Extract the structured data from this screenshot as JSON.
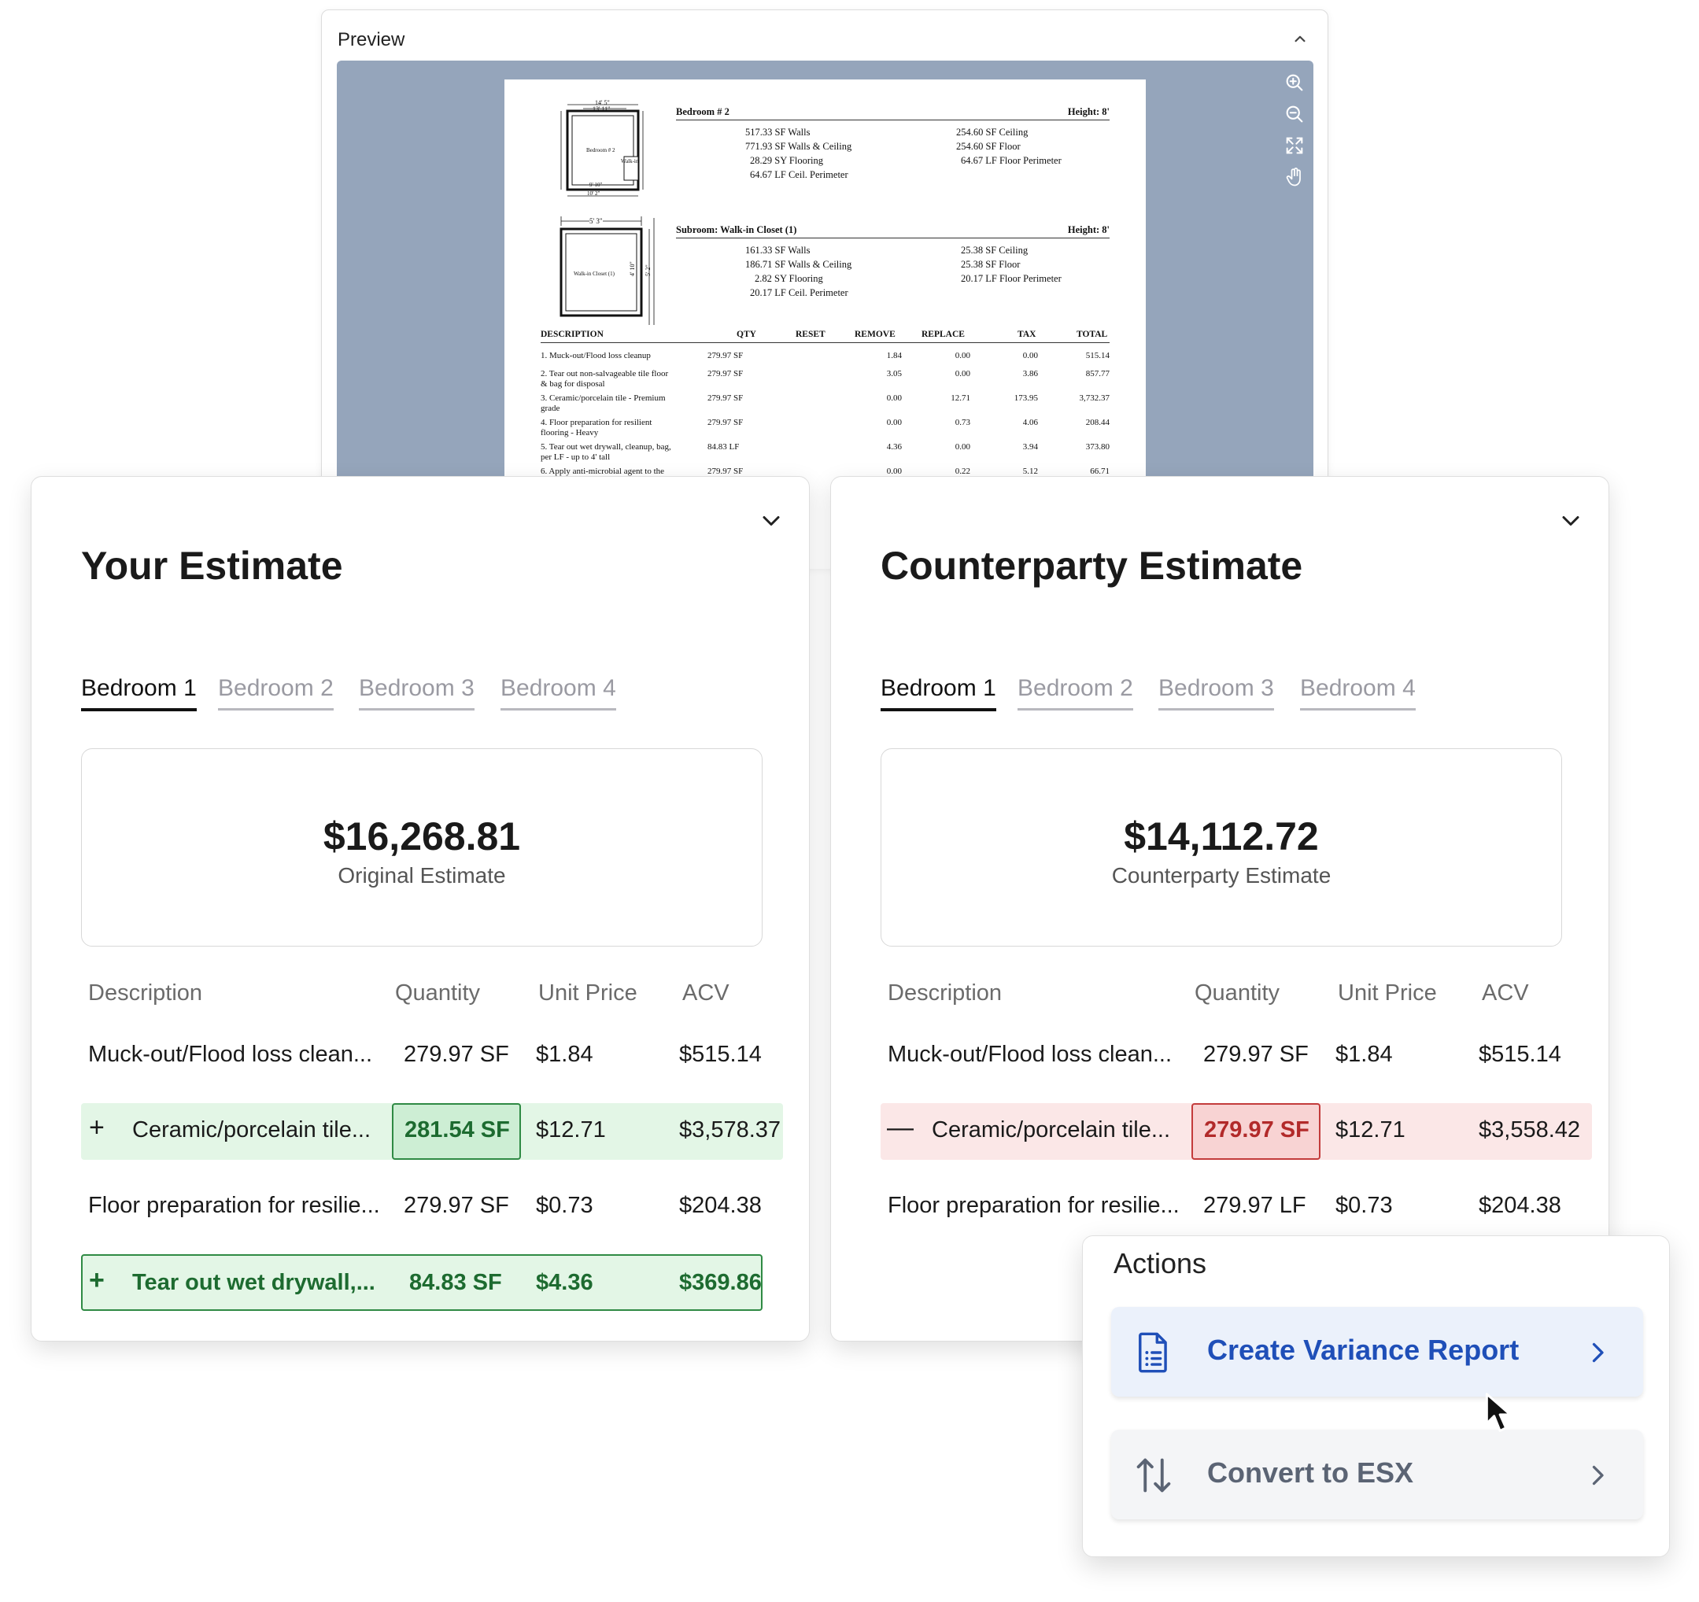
{
  "preview": {
    "title": "Preview",
    "document": {
      "room1": {
        "name": "Bedroom # 2",
        "height": "Height: 8'",
        "left_col": [
          "517.33  SF Walls",
          "771.93  SF Walls & Ceiling",
          "28.29  SY Flooring",
          "64.67  LF Ceil. Perimeter"
        ],
        "right_col": [
          "254.60  SF Ceiling",
          "254.60  SF Floor",
          "64.67  LF Floor Perimeter"
        ]
      },
      "room2": {
        "name": "Subroom:  Walk-in Closet (1)",
        "height": "Height: 8'",
        "left_col": [
          "161.33  SF Walls",
          "186.71  SF Walls & Ceiling",
          "2.82  SY Flooring",
          "20.17  LF Ceil. Perimeter"
        ],
        "right_col": [
          "25.38  SF Ceiling",
          "25.38  SF Floor",
          "20.17  LF Floor Perimeter"
        ]
      },
      "sketch_labels": {
        "bedroom_dim_top": "14' 5\"",
        "bedroom_dim_inner": "13' 11\"",
        "bedroom_label": "Bedroom # 2",
        "walkin_mark": "Walk-in",
        "bedroom_dim_bottom1": "9' 10\"",
        "bedroom_dim_bottom2": "10' 2\"",
        "closet_dim_top": "5' 3\"",
        "closet_label": "Walk-in Closet (1)",
        "closet_dim_side1": "4' 10\"",
        "closet_dim_side2": "5' 2\""
      },
      "table_headers": [
        "DESCRIPTION",
        "QTY",
        "RESET",
        "REMOVE",
        "REPLACE",
        "TAX",
        "TOTAL"
      ],
      "table_rows": [
        {
          "desc": [
            "1.  Muck-out/Flood loss cleanup"
          ],
          "qty": "279.97  SF",
          "remove": "1.84",
          "replace": "0.00",
          "tax": "0.00",
          "total": "515.14"
        },
        {
          "desc": [
            "2.  Tear out non-salvageable tile floor",
            "& bag for disposal"
          ],
          "qty": "279.97  SF",
          "remove": "3.05",
          "replace": "0.00",
          "tax": "3.86",
          "total": "857.77"
        },
        {
          "desc": [
            "3.  Ceramic/porcelain tile - Premium",
            "grade"
          ],
          "qty": "279.97  SF",
          "remove": "0.00",
          "replace": "12.71",
          "tax": "173.95",
          "total": "3,732.37"
        },
        {
          "desc": [
            "4.  Floor preparation for resilient",
            "flooring - Heavy"
          ],
          "qty": "279.97  SF",
          "remove": "0.00",
          "replace": "0.73",
          "tax": "4.06",
          "total": "208.44"
        },
        {
          "desc": [
            "5.  Tear out wet drywall, cleanup, bag,",
            "per LF - up to 4' tall"
          ],
          "qty": "84.83  LF",
          "remove": "4.36",
          "replace": "0.00",
          "tax": "3.94",
          "total": "373.80"
        },
        {
          "desc": [
            "6.  Apply anti-microbial agent to the"
          ],
          "qty": "279.97  SF",
          "remove": "0.00",
          "replace": "0.22",
          "tax": "5.12",
          "total": "66.71"
        }
      ]
    }
  },
  "your_estimate": {
    "title": "Your Estimate",
    "tabs": [
      "Bedroom 1",
      "Bedroom 2",
      "Bedroom 3",
      "Bedroom 4"
    ],
    "amount": "$16,268.81",
    "amount_label": "Original Estimate",
    "columns": [
      "Description",
      "Quantity",
      "Unit Price",
      "ACV"
    ],
    "rows": [
      {
        "sign": "",
        "description": "Muck-out/Flood loss clean...",
        "quantity": "279.97 SF",
        "unit_price": "$1.84",
        "acv": "$515.14"
      },
      {
        "sign": "+",
        "description": "Ceramic/porcelain tile...",
        "quantity": "281.54 SF",
        "unit_price": "$12.71",
        "acv": "$3,578.37"
      },
      {
        "sign": "",
        "description": "Floor preparation for resilie...",
        "quantity": "279.97 SF",
        "unit_price": "$0.73",
        "acv": "$204.38"
      },
      {
        "sign": "+",
        "description": "Tear out wet drywall,...",
        "quantity": "84.83 SF",
        "unit_price": "$4.36",
        "acv": "$369.86"
      }
    ]
  },
  "counterparty_estimate": {
    "title": "Counterparty Estimate",
    "tabs": [
      "Bedroom 1",
      "Bedroom 2",
      "Bedroom 3",
      "Bedroom 4"
    ],
    "amount": "$14,112.72",
    "amount_label": "Counterparty Estimate",
    "columns": [
      "Description",
      "Quantity",
      "Unit Price",
      "ACV"
    ],
    "rows": [
      {
        "sign": "",
        "description": "Muck-out/Flood loss clean...",
        "quantity": "279.97 SF",
        "unit_price": "$1.84",
        "acv": "$515.14"
      },
      {
        "sign": "—",
        "description": "Ceramic/porcelain tile...",
        "quantity": "279.97 SF",
        "unit_price": "$12.71",
        "acv": "$3,558.42"
      },
      {
        "sign": "",
        "description": "Floor preparation for resilie...",
        "quantity": "279.97 LF",
        "unit_price": "$0.73",
        "acv": "$204.38"
      }
    ]
  },
  "actions": {
    "title": "Actions",
    "items": [
      {
        "label": "Create Variance Report",
        "icon": "document-report-icon"
      },
      {
        "label": "Convert to ESX",
        "icon": "arrows-up-down-icon"
      }
    ]
  },
  "colors": {
    "added_bg": "#e3f6e6",
    "added_text": "#1d6b30",
    "removed_bg": "#fbe7e7",
    "removed_text": "#b22a2a",
    "primary_action": "#1f4fb8",
    "viewer_bg": "#95a5bb"
  }
}
